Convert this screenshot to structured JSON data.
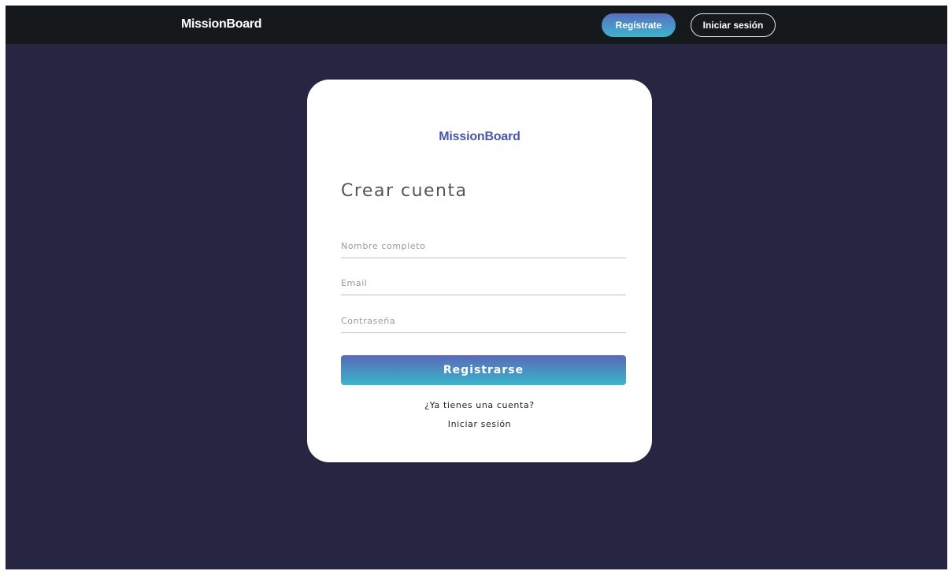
{
  "header": {
    "brand": "MissionBoard",
    "register_label": "Regístrate",
    "login_label": "Iniciar sesión"
  },
  "card": {
    "brand": "MissionBoard",
    "title": "Crear cuenta",
    "fields": {
      "name_placeholder": "Nombre completo",
      "email_placeholder": "Email",
      "password_placeholder": "Contraseña"
    },
    "submit_label": "Registrarse",
    "have_account_text": "¿Ya tienes una cuenta?",
    "login_link": "Iniciar sesión"
  },
  "colors": {
    "page_background": "#262642",
    "topbar_background": "#16191c",
    "brand_accent": "#4a57a8",
    "gradient_start": "#5a68b8",
    "gradient_end": "#3ab6ca"
  }
}
